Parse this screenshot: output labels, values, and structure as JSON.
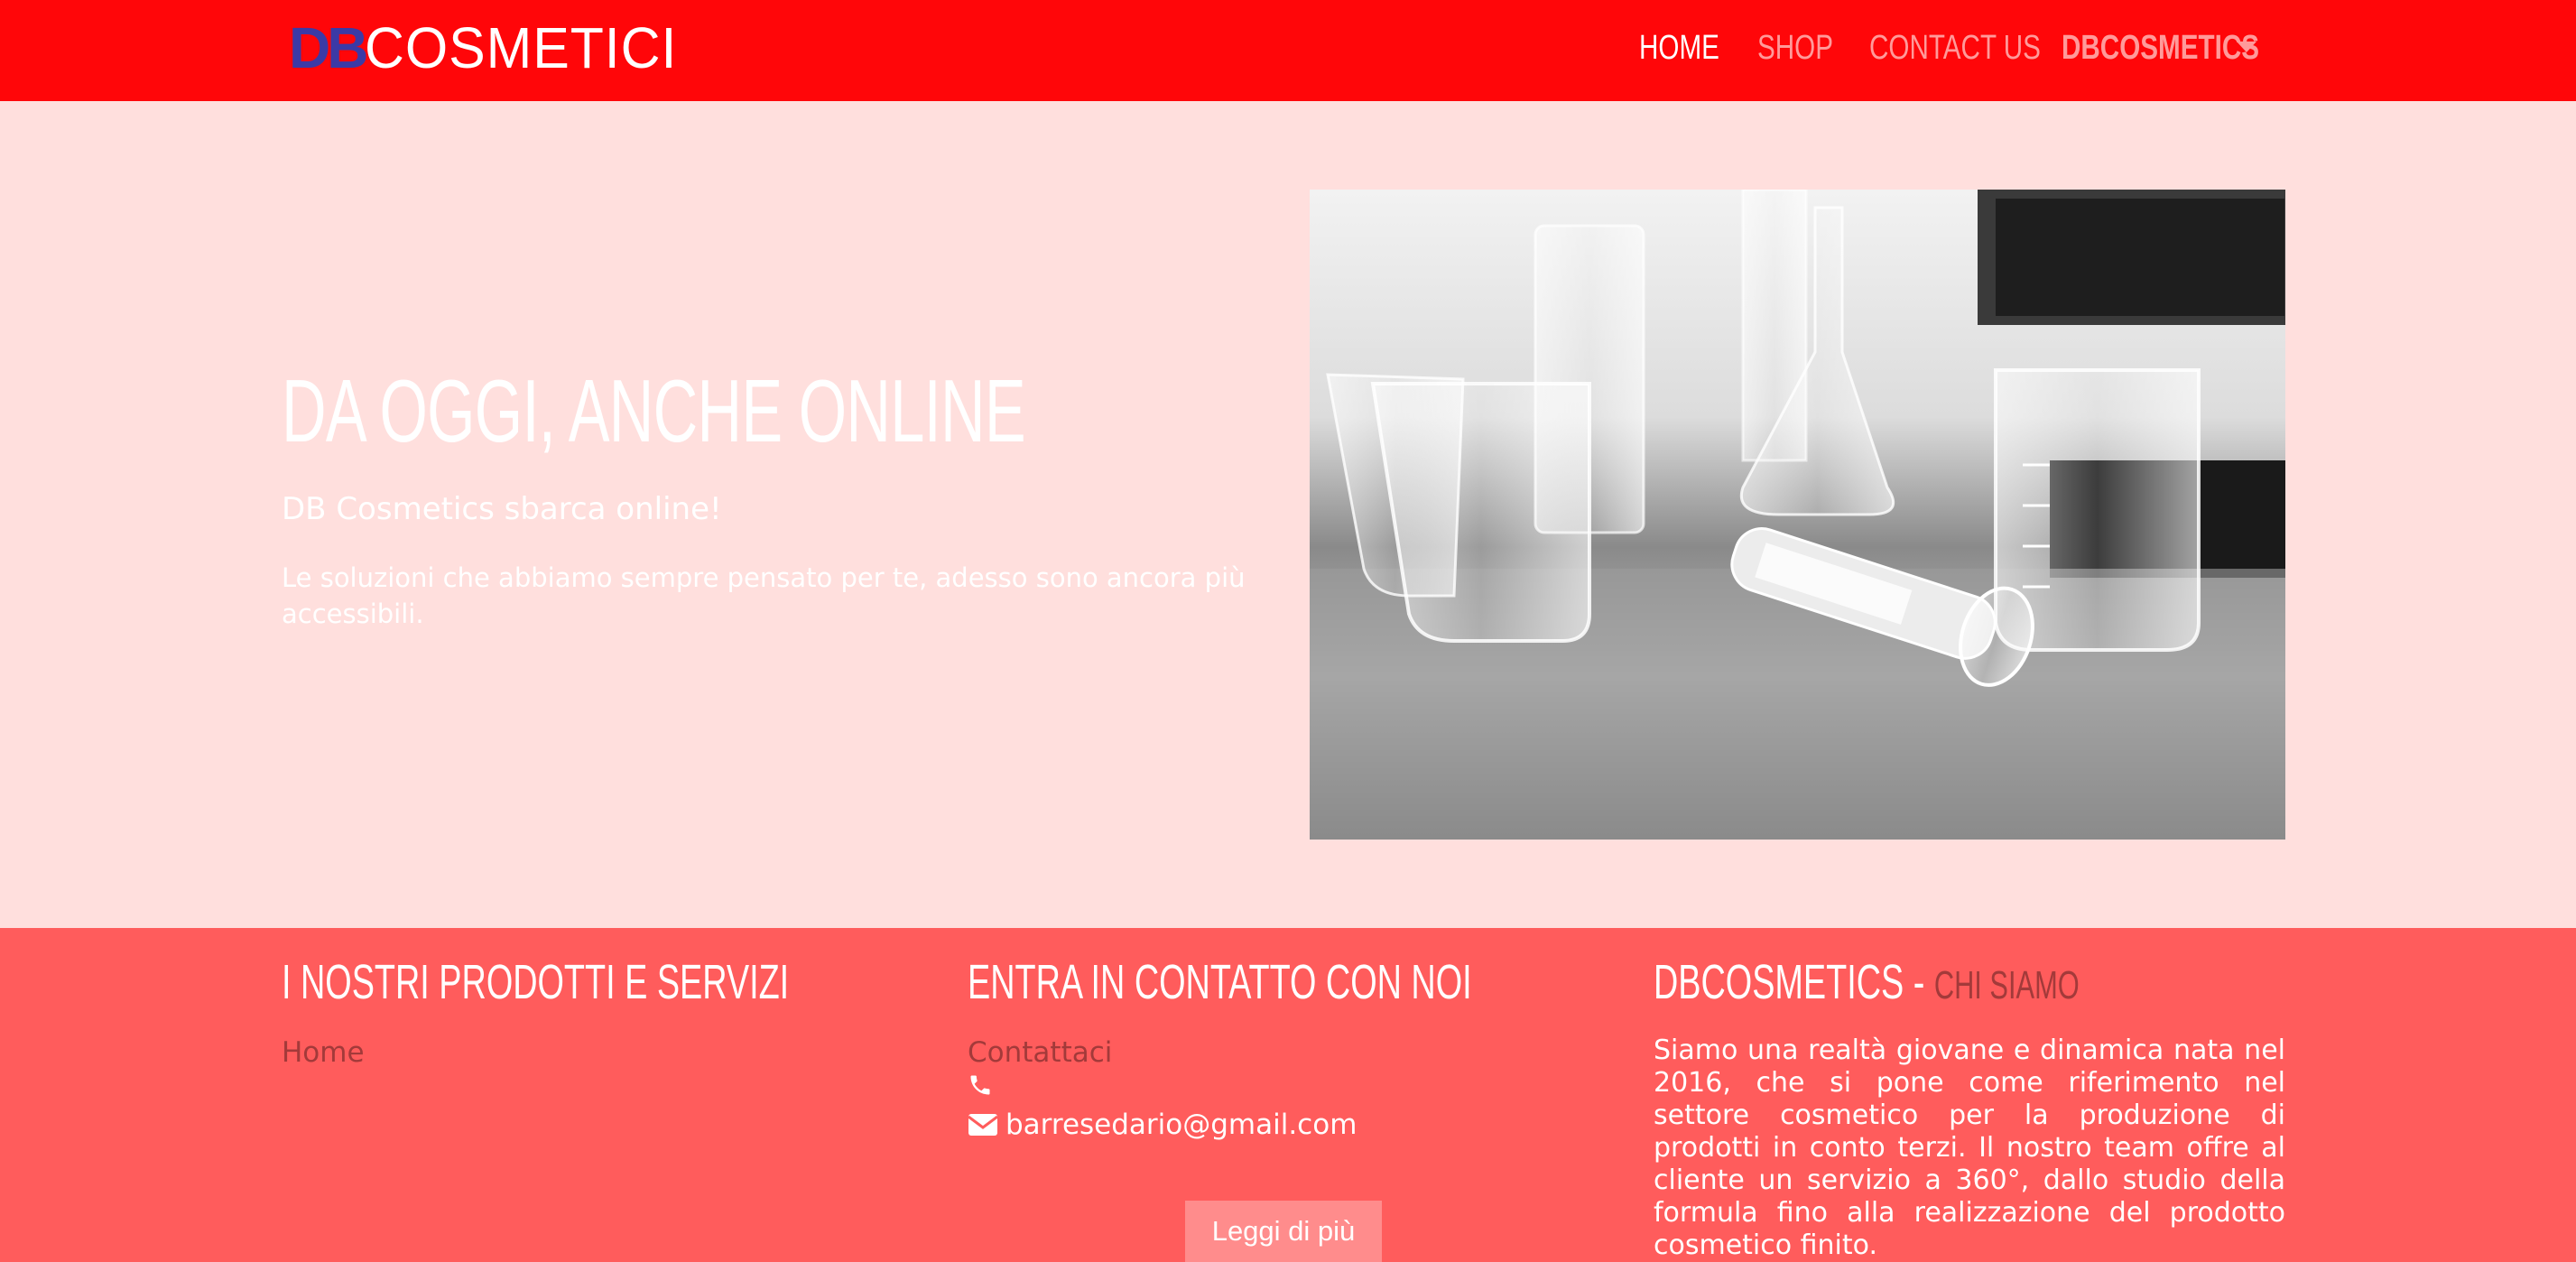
{
  "header": {
    "logo": {
      "part1": "DB",
      "part2": "COSMETICI"
    },
    "nav": {
      "home": "HOME",
      "shop": "SHOP",
      "contact": "CONTACT US",
      "dropdown": "DBCOSMETICS"
    },
    "colors": {
      "background": "#ff0609",
      "active": "#ffffff",
      "inactive": "#ff9a9a",
      "logo_accent": "#3b3aa6"
    }
  },
  "hero": {
    "title": "DA OGGI, ANCHE ONLINE",
    "subtitle": "DB Cosmetics sbarca online!",
    "text": "Le soluzioni che abbiamo sempre pensato per te, adesso sono ancora più accessibili.",
    "background": "#ffdfdd"
  },
  "footer": {
    "background": "#ff5c5c",
    "products": {
      "heading": "I NOSTRI PRODOTTI E SERVIZI",
      "link": "Home"
    },
    "contact": {
      "heading": "ENTRA IN CONTATTO CON NOI",
      "link": "Contattaci",
      "phone": "",
      "email": "barresedario@gmail.com"
    },
    "about": {
      "heading": "DBCOSMETICS - ",
      "heading_sub": "CHI SIAMO",
      "text": "Siamo una realtà giovane e dinamica nata nel 2016, che si pone come riferimento nel settore cosmetico per la produzione di prodotti in conto terzi. Il nostro team offre al cliente un servizio a 360°, dallo studio della formula fino alla realizzazione del prodotto cosmetico finito."
    },
    "read_more": "Leggi di più"
  }
}
